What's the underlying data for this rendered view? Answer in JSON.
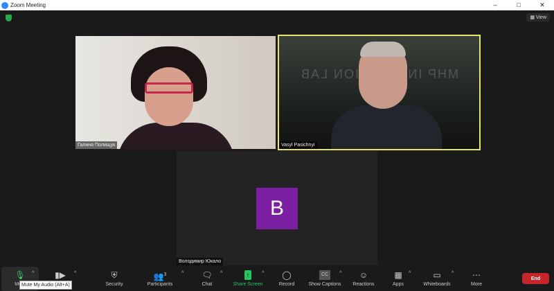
{
  "window": {
    "title": "Zoom Meeting"
  },
  "header": {
    "view_label": "View"
  },
  "participants": [
    {
      "name": "Галина Полищук"
    },
    {
      "name": "Vasyl Pasichnyi",
      "background_text": "MHP INNOVATION LAB"
    },
    {
      "name": "Володимир Юкало",
      "initial": "B",
      "avatar_color": "#7b1fa2"
    }
  ],
  "toolbar": {
    "mute": "Mute",
    "video": "",
    "security": "Security",
    "participants": "Participants",
    "participants_count": "3",
    "chat": "Chat",
    "share": "Share Screen",
    "record": "Record",
    "captions": "Show Captions",
    "reactions": "Reactions",
    "apps": "Apps",
    "whiteboards": "Whiteboards",
    "more": "More",
    "end": "End"
  },
  "tooltip": "Mute My Audio (Alt+A)",
  "colors": {
    "share": "#22c55e",
    "end": "#c4262c",
    "active_speaker": "#e8e36a"
  }
}
